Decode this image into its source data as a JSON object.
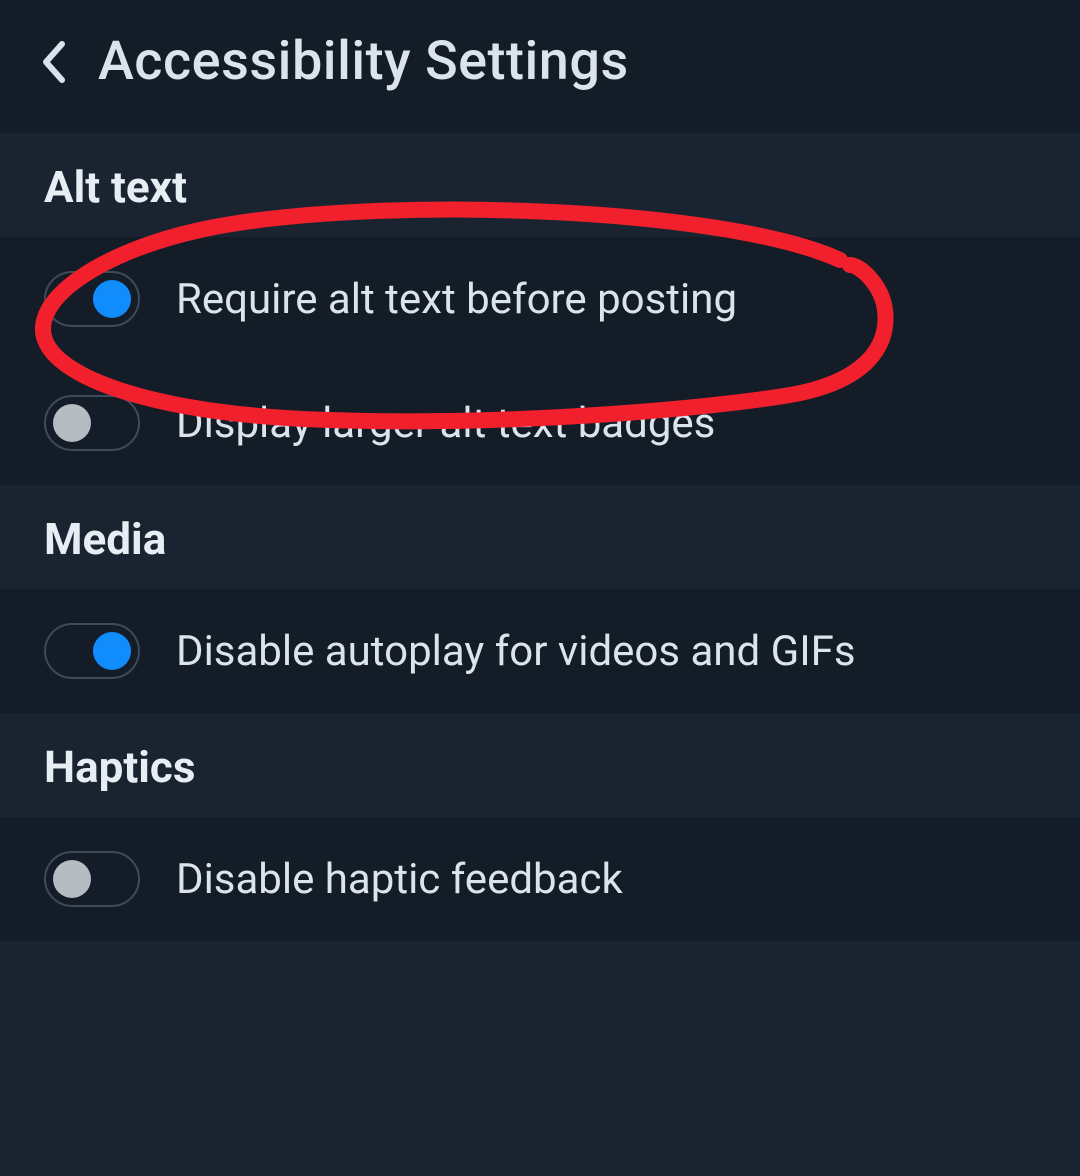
{
  "header": {
    "title": "Accessibility Settings"
  },
  "sections": {
    "alt_text": {
      "title": "Alt text",
      "items": {
        "require_alt": {
          "label": "Require alt text before posting",
          "on": true
        },
        "larger_badges": {
          "label": "Display larger alt text badges",
          "on": false
        }
      }
    },
    "media": {
      "title": "Media",
      "items": {
        "disable_autoplay": {
          "label": "Disable autoplay for videos and GIFs",
          "on": true
        }
      }
    },
    "haptics": {
      "title": "Haptics",
      "items": {
        "disable_haptics": {
          "label": "Disable haptic feedback",
          "on": false
        }
      }
    }
  },
  "colors": {
    "accent": "#118cfd",
    "annotation": "#f2202c"
  }
}
